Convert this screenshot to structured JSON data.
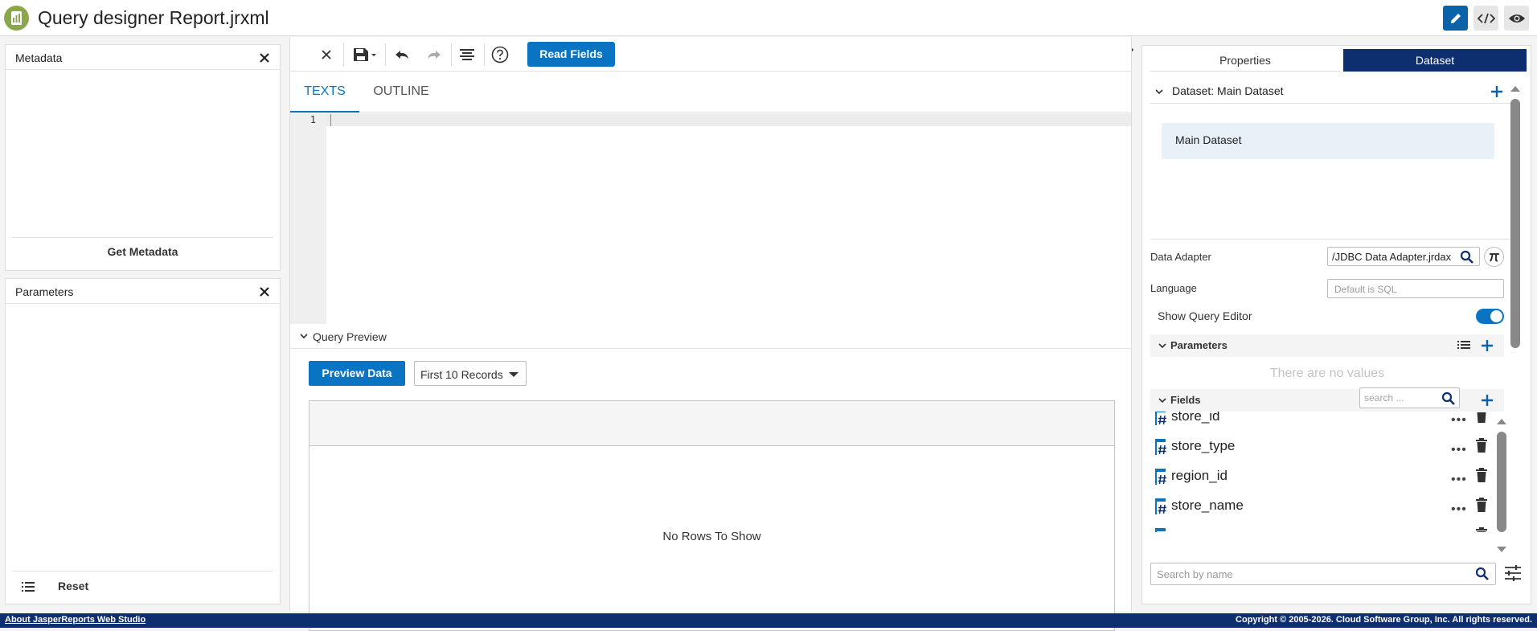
{
  "header": {
    "title": "Query designer Report.jrxml",
    "logo_icon": "report-icon",
    "buttons": [
      {
        "icon": "pencil-icon",
        "label": "Edit"
      },
      {
        "icon": "code-icon",
        "label": "Source"
      },
      {
        "icon": "eye-icon",
        "label": "Preview"
      }
    ]
  },
  "left": {
    "metadata": {
      "title": "Metadata",
      "action": "Get Metadata"
    },
    "parameters": {
      "title": "Parameters",
      "reset": "Reset"
    }
  },
  "center": {
    "toolbar": {
      "read_fields": "Read Fields"
    },
    "tabs": [
      {
        "label": "TEXTS",
        "active": true
      },
      {
        "label": "OUTLINE",
        "active": false
      }
    ],
    "editor": {
      "line_number": "1"
    },
    "query_preview": {
      "title": "Query Preview",
      "preview_button": "Preview Data",
      "records_select": "First 10 Records",
      "empty_text": "No Rows To Show"
    }
  },
  "right": {
    "tabs": [
      {
        "label": "Properties",
        "active": false
      },
      {
        "label": "Dataset",
        "active": true
      }
    ],
    "dataset_header": "Dataset: Main Dataset",
    "datasets": [
      "Main Dataset"
    ],
    "data_adapter": {
      "label": "Data Adapter",
      "value": "/JDBC Data Adapter.jrdax"
    },
    "language": {
      "label": "Language",
      "placeholder": "Default is SQL"
    },
    "show_query_editor": {
      "label": "Show Query Editor",
      "on": true
    },
    "parameters": {
      "title": "Parameters",
      "empty": "There are no values"
    },
    "fields": {
      "title": "Fields",
      "search_placeholder": "search ...",
      "items": [
        "store_id",
        "store_type",
        "region_id",
        "store_name"
      ]
    },
    "search_by_name_placeholder": "Search by name"
  },
  "footer": {
    "about": "About JasperReports Web Studio",
    "copyright": "Copyright © 2005-2026. Cloud Software Group, Inc. All rights reserved."
  },
  "colors": {
    "accent": "#0a74c2",
    "navy": "#0d2f6f",
    "logo": "#8aa84a"
  }
}
